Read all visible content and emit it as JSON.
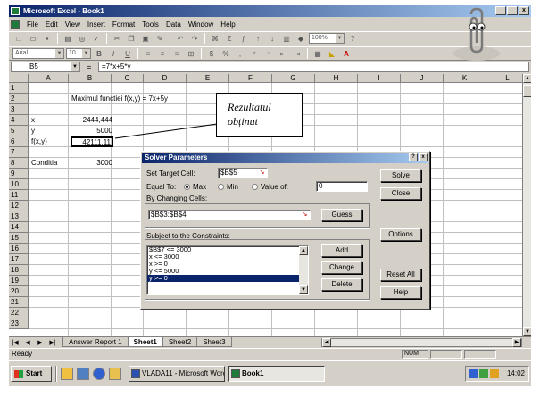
{
  "window": {
    "title": "Microsoft Excel - Book1",
    "min": "_",
    "max": " ",
    "close": "x"
  },
  "menu": [
    "File",
    "Edit",
    "View",
    "Insert",
    "Format",
    "Tools",
    "Data",
    "Window",
    "Help"
  ],
  "toolbar": {
    "zoom": "100%",
    "font": "Arial",
    "size": "10"
  },
  "formula_bar": {
    "name_box": "B5",
    "eq": "=",
    "formula": "=7*x+5*y"
  },
  "columns": [
    "A",
    "B",
    "C",
    "D",
    "E",
    "F",
    "G",
    "H",
    "I",
    "J",
    "K",
    "L"
  ],
  "rows": [
    "1",
    "2",
    "3",
    "4",
    "5",
    "6",
    "7",
    "8",
    "9",
    "10",
    "11",
    "12",
    "13",
    "14",
    "15",
    "16",
    "17",
    "18",
    "19",
    "20",
    "21",
    "22",
    "23"
  ],
  "cells": {
    "b1": "Maximul functiei f(x,y) = 7x+5y",
    "a3": "x",
    "b3": "2444,444",
    "a4": "y",
    "b4": "5000",
    "a5": "f(x,y)",
    "b5": "42111,11",
    "a7": "Conditia",
    "b7": "3000"
  },
  "callout": {
    "line1": "Rezultatul",
    "line2": "obținut"
  },
  "solver": {
    "title": "Solver Parameters",
    "help_btn": "?",
    "close_btn": "x",
    "target_label": "Set Target Cell:",
    "target_value": "$B$5",
    "equal_to_label": "Equal To:",
    "max_label": "Max",
    "min_label": "Min",
    "value_of_label": "Value of:",
    "value_of_value": "0",
    "changing_label": "By Changing Cells:",
    "changing_value": "$B$3:$B$4",
    "guess": "Guess",
    "constraints_label": "Subject to the Constraints:",
    "constraints": [
      "$B$7 <= 3000",
      "x <= 3000",
      "x >= 0",
      "y <= 5000",
      "y >= 0"
    ],
    "add": "Add",
    "change": "Change",
    "delete": "Delete",
    "solve": "Solve",
    "close": "Close",
    "options": "Options",
    "reset_all": "Reset All",
    "help": "Help"
  },
  "sheets": {
    "tabs": [
      "Answer Report 1",
      "Sheet1",
      "Sheet2",
      "Sheet3"
    ],
    "active": "Sheet1"
  },
  "status": {
    "text": "Ready",
    "num": "NUM"
  },
  "taskbar": {
    "start": "Start",
    "word_task": "VLADA11 - Microsoft Word",
    "excel_task": "Book1",
    "clock": "14:02"
  }
}
